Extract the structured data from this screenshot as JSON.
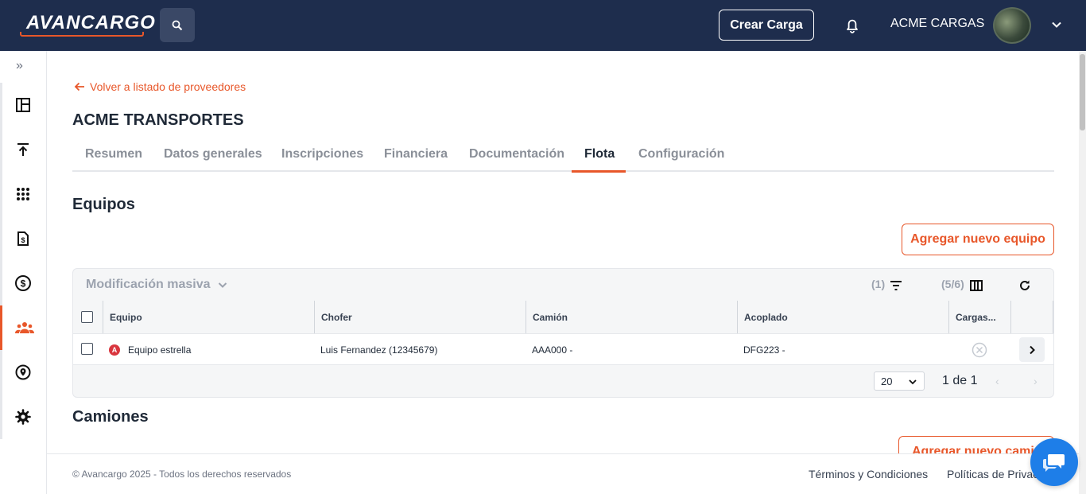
{
  "header": {
    "logo_text": "AVANCARGO",
    "create_label": "Crear Carga",
    "company_name": "ACME CARGAS"
  },
  "sidebar": {
    "items": [
      {
        "icon": "layout-icon"
      },
      {
        "icon": "upload-icon"
      },
      {
        "icon": "grid-dots-icon"
      },
      {
        "icon": "invoice-icon"
      },
      {
        "icon": "dollar-icon"
      },
      {
        "icon": "users-icon",
        "active": true
      },
      {
        "icon": "location-icon"
      },
      {
        "icon": "gear-icon"
      }
    ]
  },
  "breadcrumb": {
    "back_label": "Volver a listado de proveedores"
  },
  "page": {
    "title": "ACME TRANSPORTES"
  },
  "tabs": [
    {
      "label": "Resumen"
    },
    {
      "label": "Datos generales"
    },
    {
      "label": "Inscripciones"
    },
    {
      "label": "Financiera"
    },
    {
      "label": "Documentación"
    },
    {
      "label": "Flota",
      "active": true
    },
    {
      "label": "Configuración"
    }
  ],
  "equipos": {
    "title": "Equipos",
    "add_label": "Agregar nuevo equipo",
    "mass_label": "Modificación masiva",
    "filter_count": "(1)",
    "columns_count": "(5/6)",
    "columns": [
      "Equipo",
      "Chofer",
      "Camión",
      "Acoplado",
      "Cargas..."
    ],
    "rows": [
      {
        "equipo": "Equipo estrella",
        "badge": "A",
        "chofer": "Luis Fernandez (12345679)",
        "camion": "AAA000 -",
        "acoplado": "DFG223 -"
      }
    ],
    "page_size": "20",
    "page_info": "1 de 1"
  },
  "camiones": {
    "title": "Camiones",
    "add_label": "Agregar nuevo camión"
  },
  "footer": {
    "copyright": "© Avancargo 2025 - Todos los derechos reservados",
    "terms": "Términos y Condiciones",
    "privacy": "Políticas de Privacidad"
  },
  "colors": {
    "accent": "#e8572a",
    "navy": "#1e2d4d",
    "chat": "#1e7ee8"
  }
}
